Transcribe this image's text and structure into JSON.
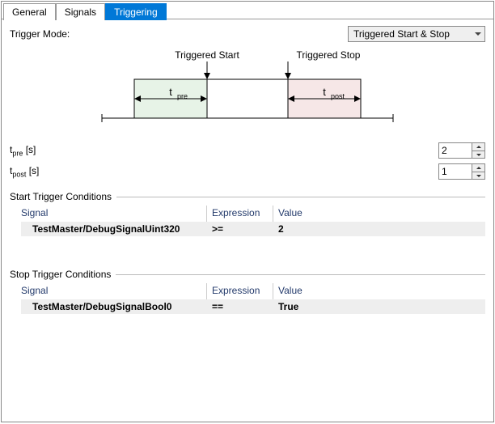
{
  "tabs": {
    "general": "General",
    "signals": "Signals",
    "triggering": "Triggering"
  },
  "triggerMode": {
    "label": "Trigger Mode:",
    "selected": "Triggered Start & Stop"
  },
  "diagram": {
    "triggeredStart": "Triggered Start",
    "triggeredStop": "Triggered Stop",
    "tpre_t": "t",
    "tpre_sub": "pre",
    "tpost_t": "t",
    "tpost_sub": "post"
  },
  "params": {
    "tpre_t": "t",
    "tpre_sub": "pre",
    "tpre_unit": " [s]",
    "tpre_val": "2",
    "tpost_t": "t",
    "tpost_sub": "post",
    "tpost_unit": " [s]",
    "tpost_val": "1"
  },
  "startGroup": {
    "title": "Start Trigger Conditions",
    "head_signal": "Signal",
    "head_expr": "Expression",
    "head_value": "Value",
    "row0_signal": "TestMaster/DebugSignalUint320",
    "row0_expr": ">=",
    "row0_value": "2"
  },
  "stopGroup": {
    "title": "Stop Trigger Conditions",
    "head_signal": "Signal",
    "head_expr": "Expression",
    "head_value": "Value",
    "row0_signal": "TestMaster/DebugSignalBool0",
    "row0_expr": "==",
    "row0_value": "True"
  }
}
